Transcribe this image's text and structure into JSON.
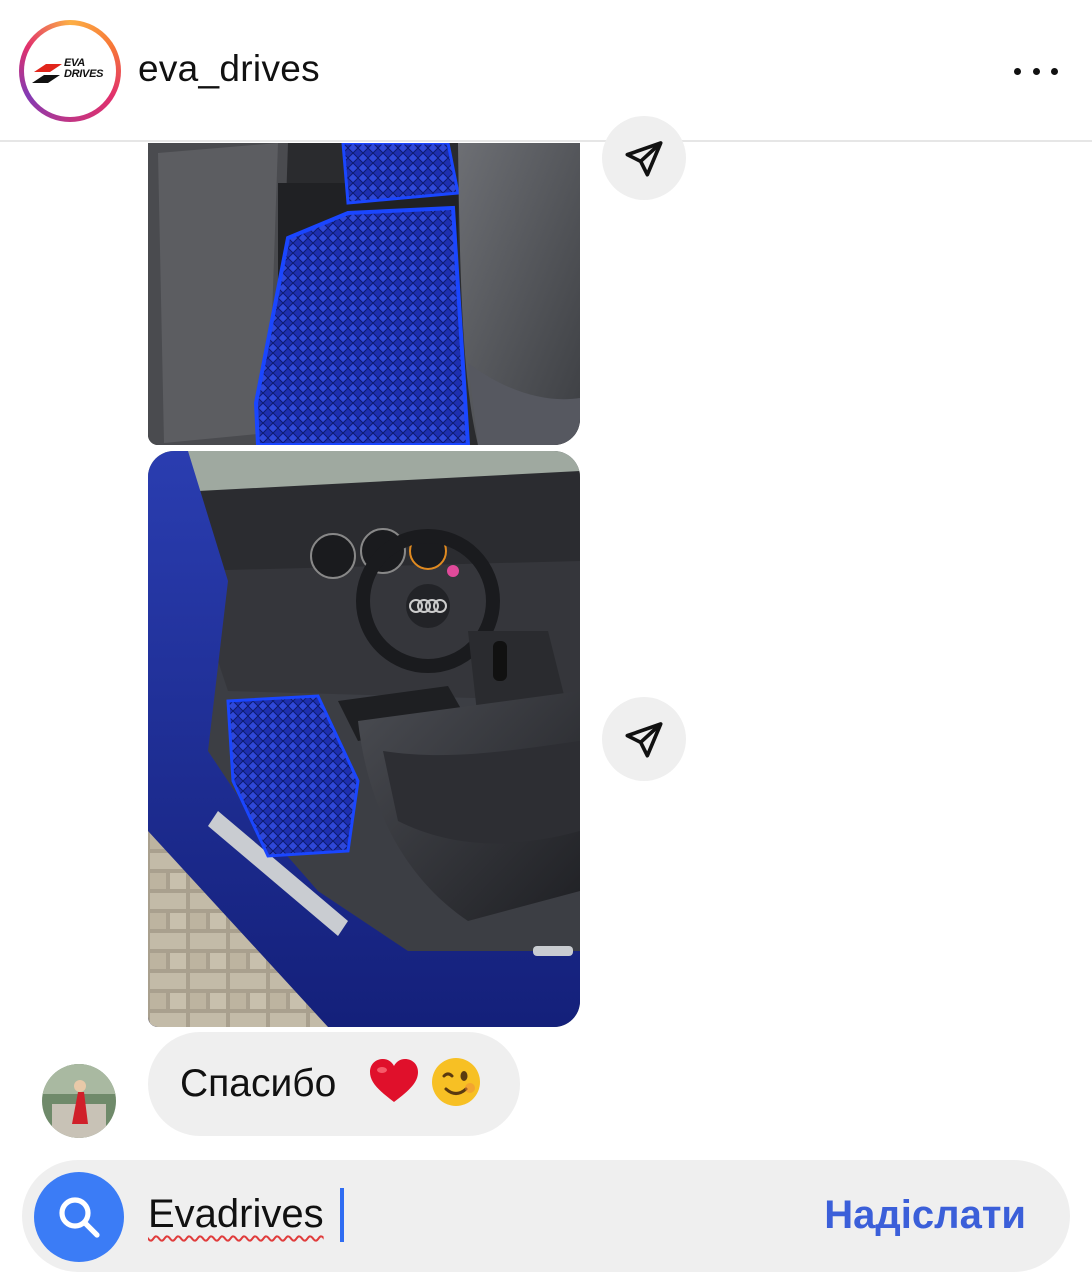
{
  "header": {
    "username": "eva_drives",
    "logo_line1": "EVA",
    "logo_line2": "DRIVES",
    "more_icon": "more-horizontal-icon"
  },
  "messages": [
    {
      "type": "image",
      "alt": "Rear blue EVA floor mat in car",
      "share_icon": "send-icon"
    },
    {
      "type": "image",
      "alt": "Audi interior with blue EVA floor mat",
      "share_icon": "send-icon"
    },
    {
      "type": "text",
      "text": "Спасибо",
      "emojis": [
        "red-heart",
        "winking-face"
      ]
    }
  ],
  "composer": {
    "value": "Evadrives",
    "send_label": "Надіслати",
    "search_icon": "search-icon"
  },
  "colors": {
    "accent": "#3b7cf6",
    "send_text": "#3b5fd9",
    "bubble": "#efefef"
  }
}
